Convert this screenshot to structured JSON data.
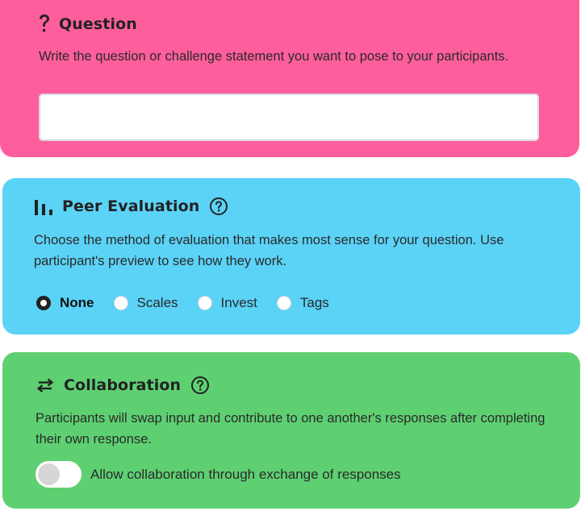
{
  "question": {
    "title": "Question",
    "description": "Write the question or challenge statement you want to pose to your participants.",
    "input_value": "",
    "input_placeholder": ""
  },
  "peer_evaluation": {
    "title": "Peer Evaluation",
    "description": "Choose the method of evaluation that makes most sense for your question. Use participant's preview to see how they work.",
    "options": [
      {
        "label": "None",
        "selected": true
      },
      {
        "label": "Scales",
        "selected": false
      },
      {
        "label": "Invest",
        "selected": false
      },
      {
        "label": "Tags",
        "selected": false
      }
    ]
  },
  "collaboration": {
    "title": "Collaboration",
    "description": "Participants will swap input and contribute to one another's responses after completing their own response.",
    "toggle_label": "Allow collaboration through exchange of responses",
    "toggle_on": false
  },
  "colors": {
    "question_bg": "#fe5f9c",
    "peer_bg": "#5bd3f7",
    "collab_bg": "#5ed072"
  },
  "icons": {
    "question": "question-mark-icon",
    "peer": "bar-chart-icon",
    "collab": "swap-arrows-icon",
    "help": "help-circle-icon"
  }
}
